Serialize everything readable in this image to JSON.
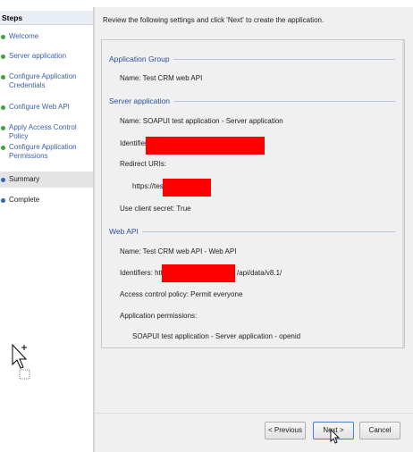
{
  "steps": {
    "header": "Steps",
    "items": [
      {
        "label": "Welcome",
        "status": "done"
      },
      {
        "label": "Server application",
        "status": "done"
      },
      {
        "label": "Configure Application Credentials",
        "status": "done"
      },
      {
        "label": "Configure Web API",
        "status": "done"
      },
      {
        "label": "Apply Access Control Policy",
        "status": "done"
      },
      {
        "label": "Configure Application Permissions",
        "status": "done"
      },
      {
        "label": "Summary",
        "status": "current"
      },
      {
        "label": "Complete",
        "status": "pending"
      }
    ]
  },
  "intro": "Review the following settings and click 'Next' to create the application.",
  "summary": {
    "application_group": {
      "title": "Application Group",
      "name": "Name: Test CRM web API"
    },
    "server_application": {
      "title": "Server application",
      "name": "Name: SOAPUI test application - Server application",
      "identifier_label": "Identifier",
      "redirect_label": "Redirect URIs:",
      "redirect_value": "https://test",
      "client_secret": "Use client secret: True"
    },
    "web_api": {
      "title": "Web API",
      "name": "Name: Test CRM web API - Web API",
      "identifiers_prefix": "Identifiers: https",
      "identifiers_suffix": "/api/data/v8.1/",
      "access_policy": "Access control policy: Permit everyone",
      "permissions_label": "Application permissions:",
      "permission_item": "SOAPUI test application - Server application - openid"
    }
  },
  "buttons": {
    "previous": "< Previous",
    "next": "Next >",
    "cancel": "Cancel"
  },
  "colors": {
    "redaction": "#ff0000",
    "step_done": "#3da23d",
    "step_pending": "#2f63c5",
    "section_title": "#2a4f9c"
  }
}
